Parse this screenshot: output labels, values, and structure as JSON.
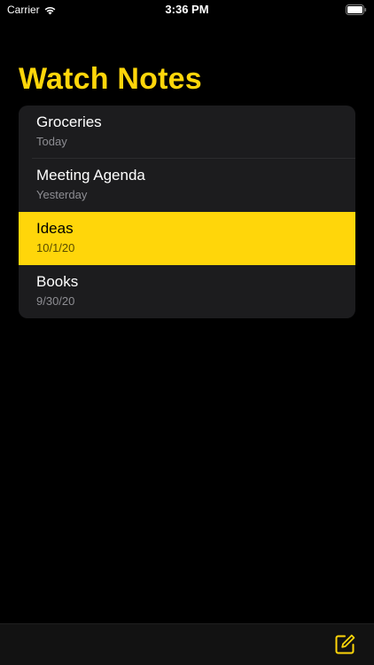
{
  "status_bar": {
    "carrier": "Carrier",
    "time": "3:36 PM"
  },
  "header": {
    "title": "Watch Notes"
  },
  "notes": [
    {
      "title": "Groceries",
      "date": "Today",
      "selected": false
    },
    {
      "title": "Meeting Agenda",
      "date": "Yesterday",
      "selected": false
    },
    {
      "title": "Ideas",
      "date": "10/1/20",
      "selected": true
    },
    {
      "title": "Books",
      "date": "9/30/20",
      "selected": false
    }
  ],
  "toolbar": {
    "compose_icon": "compose-icon"
  },
  "colors": {
    "accent": "#ffd60a",
    "background": "#000000",
    "list_background": "#1c1c1e",
    "secondary_text": "#8e8e93"
  }
}
